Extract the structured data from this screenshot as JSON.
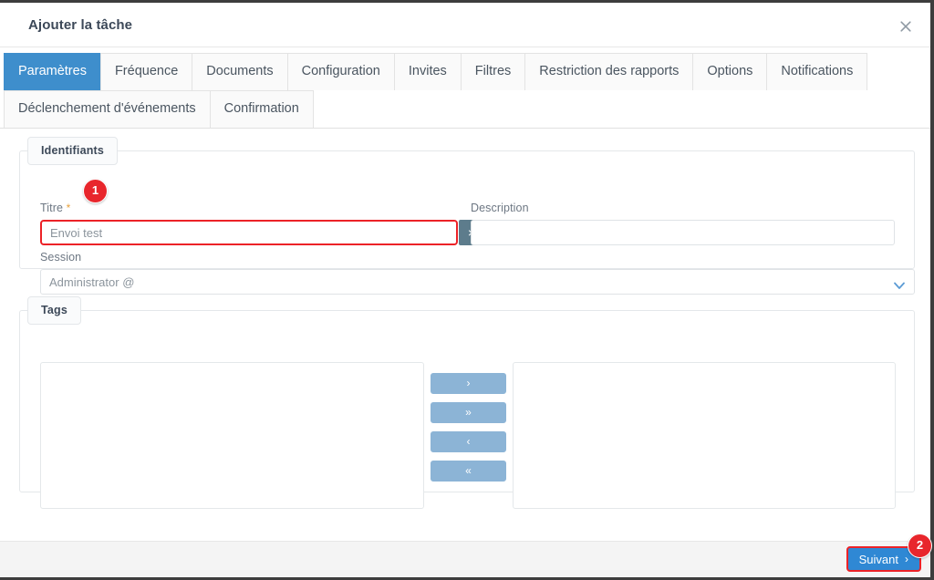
{
  "header": {
    "title": "Ajouter la tâche",
    "close_icon": "close-icon"
  },
  "tabs": [
    {
      "label": "Paramètres",
      "active": true
    },
    {
      "label": "Fréquence",
      "active": false
    },
    {
      "label": "Documents",
      "active": false
    },
    {
      "label": "Configuration",
      "active": false
    },
    {
      "label": "Invites",
      "active": false
    },
    {
      "label": "Filtres",
      "active": false
    },
    {
      "label": "Restriction des rapports",
      "active": false
    },
    {
      "label": "Options",
      "active": false
    },
    {
      "label": "Notifications",
      "active": false
    },
    {
      "label": "Déclenchement d'événements",
      "active": false
    },
    {
      "label": "Confirmation",
      "active": false
    }
  ],
  "identifiants": {
    "legend": "Identifiants",
    "titre": {
      "label": "Titre",
      "required_marker": "*",
      "value": "Envoi test",
      "clear_icon": "×"
    },
    "description": {
      "label": "Description",
      "value": ""
    },
    "session": {
      "label": "Session",
      "value": "Administrator @",
      "chevron_icon": "chevron-down-icon"
    }
  },
  "tags": {
    "legend": "Tags",
    "available_items": [],
    "selected_items": [],
    "transfer_buttons": [
      {
        "label": "›",
        "name": "move-right-button"
      },
      {
        "label": "»",
        "name": "move-all-right-button"
      },
      {
        "label": "‹",
        "name": "move-left-button"
      },
      {
        "label": "«",
        "name": "move-all-left-button"
      }
    ]
  },
  "footer": {
    "next_label": "Suivant",
    "next_chevron": "›"
  },
  "annotations": [
    {
      "number": "1",
      "target": "titre-input"
    },
    {
      "number": "2",
      "target": "next-button"
    }
  ],
  "colors": {
    "active_tab": "#3e8ecc",
    "primary_button": "#2f88d4",
    "annotation_red": "#e8262c",
    "transfer_button": "#8cb4d6",
    "clear_button": "#5d7c8c"
  }
}
